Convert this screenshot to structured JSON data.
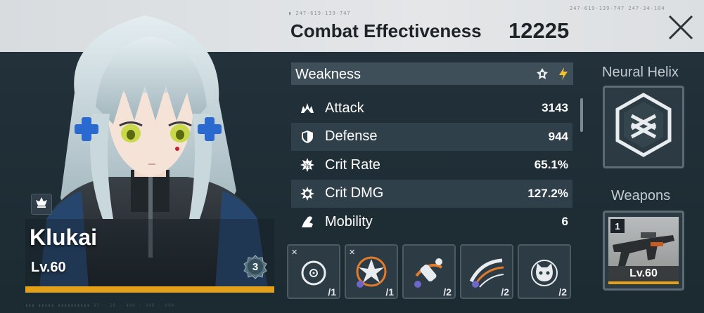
{
  "header": {
    "title": "Combat Effectiveness",
    "value": "12225"
  },
  "character": {
    "name": "Klukai",
    "level": "Lv.60",
    "rank": "3",
    "class_icon": "vanguard-class-icon"
  },
  "weakness": {
    "label": "Weakness",
    "icons": [
      "pierce-weakness-icon",
      "electric-weakness-icon"
    ],
    "electric_color": "#f2c230"
  },
  "stats": [
    {
      "label": "Attack",
      "value": "3143",
      "icon": "attack-icon"
    },
    {
      "label": "Defense",
      "value": "944",
      "icon": "defense-icon"
    },
    {
      "label": "Crit Rate",
      "value": "65.1%",
      "icon": "crit-rate-icon"
    },
    {
      "label": "Crit DMG",
      "value": "127.2%",
      "icon": "crit-dmg-icon"
    },
    {
      "label": "Mobility",
      "value": "6",
      "icon": "mobility-icon"
    }
  ],
  "skills": [
    {
      "count": "/1",
      "locked": "✕",
      "icon": "target-skill-icon"
    },
    {
      "count": "/1",
      "locked": "✕",
      "icon": "burst-skill-icon"
    },
    {
      "count": "/2",
      "locked": "",
      "icon": "dash-skill-icon"
    },
    {
      "count": "/2",
      "locked": "",
      "icon": "sweep-skill-icon"
    },
    {
      "count": "/2",
      "locked": "",
      "icon": "cat-skill-icon"
    }
  ],
  "sidebar": {
    "helix_title": "Neural Helix",
    "weapons_title": "Weapons",
    "weapon_rank": "1",
    "weapon_level": "Lv.60"
  },
  "colors": {
    "accent": "#e3a11a",
    "panel": "#1f2c33",
    "header_band": "#e0e3e5"
  }
}
